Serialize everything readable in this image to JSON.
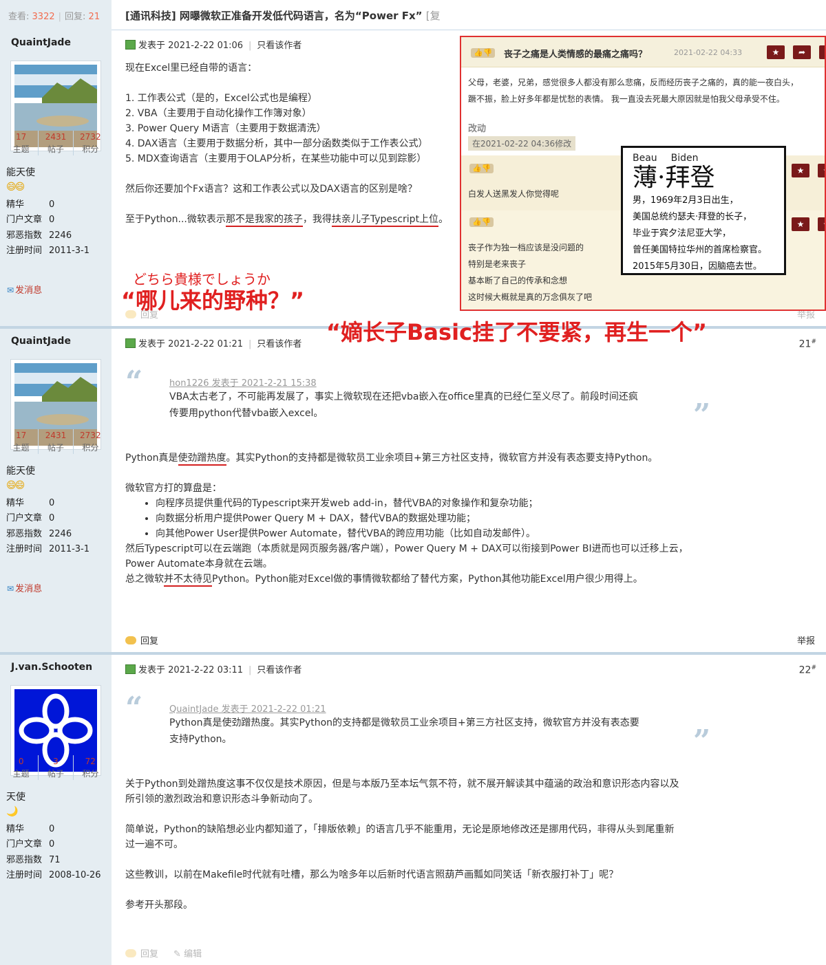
{
  "header": {
    "views_label": "查看:",
    "views": "3322",
    "replies_label": "回复:",
    "replies": "21",
    "title": "[通讯科技] 网曝微软正准备开发低代码语言，名为“Power Fx”",
    "title_rest": "[复"
  },
  "common": {
    "posted_prefix": "发表于",
    "only_author": "只看该作者",
    "reply": "回复",
    "report": "举报",
    "edit": "编辑",
    "send_message": "发消息",
    "stat_labels": [
      "主题",
      "帖子",
      "积分"
    ],
    "info_labels": [
      "精华",
      "门户文章",
      "邪恶指数",
      "注册时间"
    ]
  },
  "posts": [
    {
      "user": {
        "name": "QuaintJade",
        "stats": [
          "17",
          "2431",
          "2732"
        ],
        "rank": "能天使",
        "emoticons": "😄😄",
        "info": [
          "0",
          "0",
          "2246",
          "2011-3-1"
        ]
      },
      "posted_at": "2021-2-22 01:06",
      "lines": [
        "现在Excel里已经自带的语言：",
        "",
        "1. 工作表公式（是的，Excel公式也是编程）",
        "2. VBA（主要用于自动化操作工作簿对象）",
        "3. Power Query M语言（主要用于数据清洗）",
        "4. DAX语言（主要用于数据分析，其中一部分函数类似于工作表公式）",
        "5. MDX查询语言（主要用于OLAP分析，在某些功能中可以见到踪影）",
        "",
        "然后你还要加个Fx语言？这和工作表公式以及DAX语言的区别是啥？",
        ""
      ],
      "last_line": {
        "a": "至于Python...微软表示",
        "b": "那不是我家的孩子",
        "c": "，我得",
        "d": "扶亲儿子Typescript上位",
        "e": "。"
      },
      "annotation_ja": "どちら貴様でしょうか",
      "annotation_1": "“哪儿来的野种？”",
      "annotation_2": "“嫡长子Basic挂了不要紧，再生一个”"
    },
    {
      "user": {
        "name": "QuaintJade",
        "stats": [
          "17",
          "2431",
          "2732"
        ],
        "rank": "能天使",
        "emoticons": "😄😄",
        "info": [
          "0",
          "0",
          "2246",
          "2011-3-1"
        ]
      },
      "posted_at": "2021-2-22 01:21",
      "floor": "21",
      "quote": {
        "author": "hon1226 发表于 2021-2-21 15:38",
        "lines": [
          "VBA太古老了，不可能再发展了，事实上微软现在还把vba嵌入在office里真的已经仁至义尽了。前段时间还疯",
          "传要用python代替vba嵌入excel。"
        ]
      },
      "line1": {
        "a": "Python真是",
        "b": "使劲蹭热度",
        "c": "。其实Python的支持都是微软员工业余项目+第三方社区支持，微软官方并没有表态要支持Python。"
      },
      "line2": "微软官方打的算盘是：",
      "bullets": [
        "向程序员提供重代码的Typescript来开发web add-in，替代VBA的对象操作和复杂功能；",
        "向数据分析用户提供Power Query M + DAX，替代VBA的数据处理功能；",
        "向其他Power User提供Power Automate，替代VBA的跨应用功能（比如自动发邮件）。"
      ],
      "line3": "然后Typescript可以在云端跑（本质就是网页服务器/客户端），Power Query M + DAX可以衔接到Power BI进而也可以迁移上云，",
      "line4": "Power Automate本身就在云端。",
      "line5": {
        "a": "总之微软",
        "b": "并不太待见",
        "c": "Python。Python能对Excel做的事情微软都给了替代方案，Python其他功能Excel用户很少用得上。"
      }
    },
    {
      "user": {
        "name": "J.van.Schooten",
        "stats": [
          "0",
          "3",
          "72"
        ],
        "rank": "天使",
        "emoticons": "🌙",
        "info": [
          "0",
          "0",
          "71",
          "2008-10-26"
        ]
      },
      "posted_at": "2021-2-22 03:11",
      "floor": "22",
      "quote": {
        "author": "QuaintJade 发表于 2021-2-22 01:21",
        "lines": [
          "Python真是使劲蹭热度。其实Python的支持都是微软员工业余项目+第三方社区支持，微软官方并没有表态要",
          "支持Python。"
        ]
      },
      "lines": [
        "关于Python到处蹭热度这事不仅仅是技术原因，但是与本版乃至本坛气氛不符，就不展开解读其中蕴涵的政治和意识形态内容以及",
        "所引领的激烈政治和意识形态斗争新动向了。",
        "",
        "简单说，Python的缺陷想必业内都知道了，「排版依赖」的语言几乎不能重用，无论是原地修改还是挪用代码，非得从头到尾重新",
        "过一遍不可。",
        "",
        "这些教训，以前在Makefile时代就有吐槽，那么为啥多年以后新时代语言照葫芦画瓢如同笑话「新衣服打补丁」呢？",
        "",
        "参考开头那段。"
      ]
    }
  ],
  "inset": {
    "title": "丧子之痛是人类情感的最痛之痛吗？",
    "date": "2021-02-22 04:33",
    "para": [
      "父母，老婆，兄弟，感觉很多人都没有那么悲痛，反而经历丧子之痛的，真的能一夜白头，",
      "蹶不振，脸上好多年都是忧愁的表情。 我一直没去死最大原因就是怕我父母承受不住。"
    ],
    "edit_label": "改动",
    "edit_note": "在2021-02-22 04:36修改",
    "answer1": "白发人送黑发人你觉得呢",
    "answer2": [
      "丧子作为独一档应该是没问题的",
      "特别是老来丧子",
      "基本断了自己的传承和念想",
      "这时候大概就是真的万念俱灰了吧"
    ]
  },
  "bio": {
    "en_first": "Beau",
    "en_last": "Biden",
    "zh_name": "薄·拜登",
    "lines": [
      "男，1969年2月3日出生，",
      "美国总统约瑟夫·拜登的长子，",
      "毕业于宾夕法尼亚大学，",
      "曾任美国特拉华州的首席检察官。",
      "2015年5月30日，因脑癌去世。"
    ]
  }
}
